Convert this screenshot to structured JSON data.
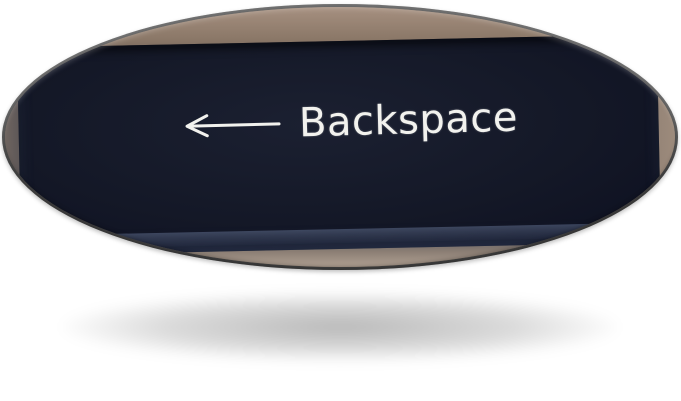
{
  "key": {
    "label": "Backspace",
    "arrow_icon": "left-arrow-icon"
  },
  "colors": {
    "keycap": "#141827",
    "legend": "#f2f2ee",
    "frame": "#4a4a4a"
  }
}
